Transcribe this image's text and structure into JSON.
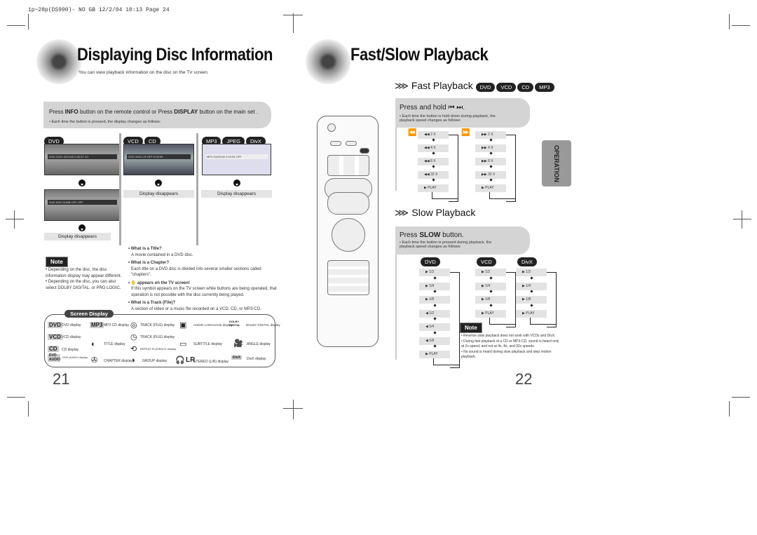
{
  "header": "1p~28p(DS990)- NO GB  12/2/04 10:13  Page 24",
  "left": {
    "title": "Displaying Disc Information",
    "subtitle": "You can view playback information on the disc on the TV screen.",
    "instruction": {
      "pre": "Press ",
      "k1": "INFO",
      "mid": " button on the remote control or Press ",
      "k2": "DISPLAY",
      "post": " button on the main set ."
    },
    "instruction_note": "• Each time the button is pressed, the display changes as follows:",
    "columns": [
      {
        "badges": [
          "DVD"
        ],
        "osd1": "DVD  01/01  001/040  0:00:37  1/1",
        "osd2": "DVD  ENG  DUBB  OFF  OFF",
        "disappears": "Display disappears"
      },
      {
        "badges": [
          "VCD",
          "CD"
        ],
        "osd1": "VCD  02/02  LR  OFF  0:00:39",
        "disappears": "Display disappears"
      },
      {
        "badges": [
          "MP3",
          "JPEG",
          "DivX"
        ],
        "osd1": "MP3  002/0040  0:00:05  OFF",
        "disappears": "Display disappears"
      }
    ],
    "note_label": "Note",
    "notes": [
      "• Depending on the disc, the disc information display may appear different.",
      "• Depending on the disc, you can also select DOLBY DIGITAL, or PRO LOGIC."
    ],
    "qa": [
      {
        "q": "• What is a Title?",
        "a": "A movie contained in a DVD disc."
      },
      {
        "q": "• What is a Chapter?",
        "a": "Each title on a DVD disc is divided into several smaller sections called \"chapters\"."
      },
      {
        "q": "• ✋ appears on the TV screen!",
        "a": "If this symbol appears on the TV screen while buttons are being operated, that operation is not possible with the disc currently being played."
      },
      {
        "q": "• What is a Track (File)?",
        "a": "A section of video or a music file recorded on a VCD, CD, or MP3-CD."
      }
    ],
    "screen_display": {
      "title": "Screen Display",
      "items": [
        {
          "tag": "DVD",
          "label": "DVD display"
        },
        {
          "tag": "VCD",
          "label": "VCD display"
        },
        {
          "tag": "CD",
          "label": "CD display"
        },
        {
          "tag": "DVD AUDIO",
          "label": "DVD-AUDIO display"
        },
        {
          "tag": "MP3",
          "label": "MP3 CD display"
        },
        {
          "label": "TITLE display"
        },
        {
          "label": "CHAPTER display"
        },
        {
          "label": "TRACK (FILE) display"
        },
        {
          "label": "TRACK (FILE) display"
        },
        {
          "label": "REPEAT PLAYBACK display"
        },
        {
          "label": "GROUP display"
        },
        {
          "label": "AUDIO LANGUAGE display"
        },
        {
          "label": "SUBTITLE display"
        },
        {
          "tag": "LR",
          "label": "STEREO (L/R) display"
        },
        {
          "tag": "DOLBY DIGITAL",
          "label": "DOLBY DIGITAL display"
        },
        {
          "label": "ANGLE display"
        },
        {
          "tag": "DivX",
          "label": "DivX display"
        }
      ]
    },
    "page_number": "21"
  },
  "right": {
    "title": "Fast/Slow Playback",
    "fast": {
      "title": "Fast Playback",
      "badges": [
        "DVD",
        "VCD",
        "CD",
        "MP3"
      ],
      "instruction": "Press and hold ⏮ ⏭.",
      "note": "• Each time the button is held down during playback, the playback speed changes as follows:",
      "rev": [
        "◀◀  2 X",
        "◀◀  4 X",
        "◀◀  8 X",
        "◀◀  32 X",
        "▶  PLAY"
      ],
      "fwd": [
        "▶▶  2 X",
        "▶▶  4 X",
        "▶▶  8 X",
        "▶▶  32 X",
        "▶  PLAY"
      ]
    },
    "slow": {
      "title": "Slow Playback",
      "instruction_pre": "Press  ",
      "instruction_key": "SLOW",
      "instruction_post": " button.",
      "note": "• Each time the button is pressed during playback, the playback speed changes as follows:",
      "columns": [
        {
          "badge": "DVD",
          "steps": [
            "▶  1/2",
            "▶  1/4",
            "▶  1/8",
            "◀  1/2",
            "◀  1/4",
            "◀  1/8",
            "▶  PLAY"
          ]
        },
        {
          "badge": "VCD",
          "steps": [
            "▶  1/2",
            "▶  1/4",
            "▶  1/8",
            "▶  PLAY"
          ]
        },
        {
          "badge": "DivX",
          "steps": [
            "▶  1/2",
            "▶  1/4",
            "▶  1/8",
            "▶  PLAY"
          ]
        }
      ]
    },
    "note_label": "Note",
    "notes": [
      "• Reverse slow playback does not work with VCDs and DivX.",
      "• During fast playback of a CD or MP3-CD, sound is heard only at 2x speed, and not at 4x, 8x, and 32x speeds.",
      "• No sound is heard during slow playback and step motion playback."
    ],
    "side_tab": "OPERATION",
    "page_number": "22"
  }
}
